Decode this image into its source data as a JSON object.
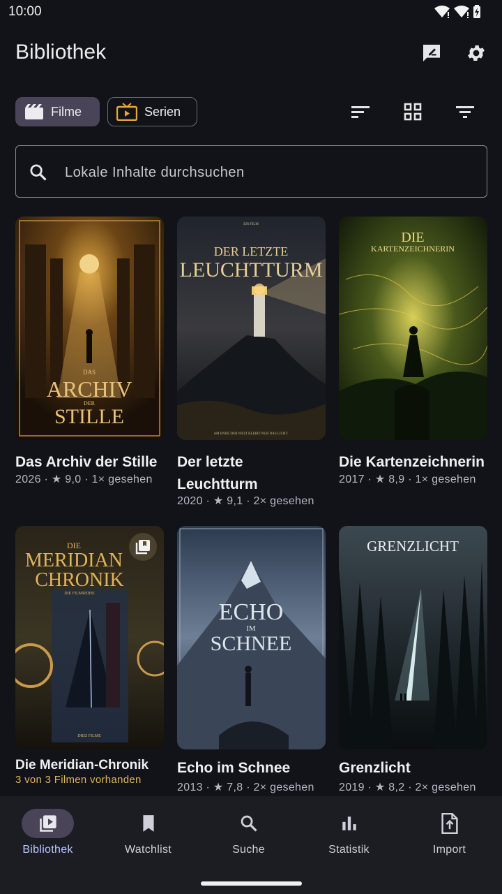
{
  "status": {
    "time": "10:00"
  },
  "appbar": {
    "title": "Bibliothek"
  },
  "chips": {
    "films": "Filme",
    "series": "Serien"
  },
  "search": {
    "placeholder": "Lokale Inhalte durchsuchen"
  },
  "items": [
    {
      "title": "Das Archiv der Stille",
      "meta": "2026 · ★ 9,0 · 1× gesehen",
      "poster_lines": [
        "DAS",
        "ARCHIV",
        "DER",
        "STILLE"
      ]
    },
    {
      "title": "Der letzte Leuchtturm",
      "meta": "2020 · ★ 9,1 · 2× gesehen",
      "poster_lines": [
        "EIN FILM",
        "DER LETZTE",
        "LEUCHTTURM",
        "AM ENDE DER WELT BLEIBT NUR DAS LICHT."
      ]
    },
    {
      "title": "Die Kartenzeichnerin",
      "meta": "2017 · ★ 8,9 · 1× gesehen",
      "poster_lines": [
        "DIE",
        "KARTENZEICHNERIN"
      ]
    },
    {
      "title": "Die Meridian-Chronik",
      "meta": "3 von 3 Filmen vorhanden",
      "poster_lines": [
        "DIE",
        "MERIDIAN",
        "CHRONIK",
        "DIE FILMREIHE",
        "DREI FILME"
      ]
    },
    {
      "title": "Echo im Schnee",
      "meta": "2013 · ★ 7,8 · 2× gesehen",
      "poster_lines": [
        "ECHO",
        "IM",
        "SCHNEE"
      ]
    },
    {
      "title": "Grenzlicht",
      "meta": "2019 · ★ 8,2 · 2× gesehen",
      "poster_lines": [
        "GRENZLICHT"
      ]
    }
  ],
  "nav": [
    {
      "label": "Bibliothek",
      "icon": "library-icon",
      "active": true
    },
    {
      "label": "Watchlist",
      "icon": "bookmark-icon"
    },
    {
      "label": "Suche",
      "icon": "search-icon"
    },
    {
      "label": "Statistik",
      "icon": "bar-chart-icon"
    },
    {
      "label": "Import",
      "icon": "file-upload-icon"
    }
  ],
  "colors": {
    "background": "#111318",
    "accent_pill": "#4a4458",
    "nav_active_text": "#b9c8ff",
    "collection_text": "#e0b45a"
  }
}
